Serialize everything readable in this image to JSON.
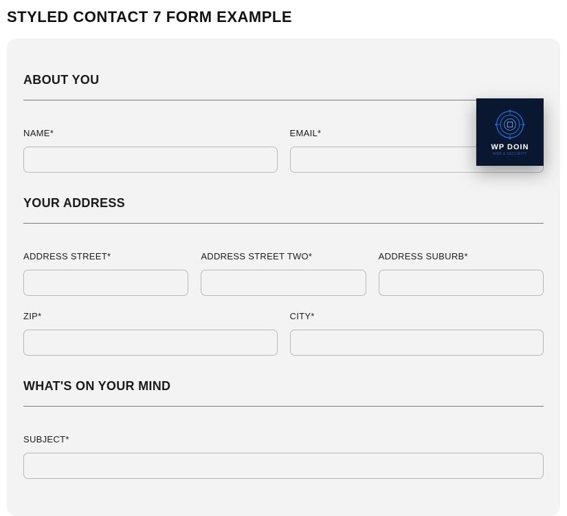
{
  "pageTitle": "STYLED CONTACT 7 FORM EXAMPLE",
  "badge": {
    "text": "WP DOIN",
    "sub": "WEB & SECURITY"
  },
  "sections": {
    "about": {
      "title": "ABOUT YOU",
      "fields": {
        "name": {
          "label": "NAME*",
          "value": ""
        },
        "email": {
          "label": "EMAIL*",
          "value": ""
        }
      }
    },
    "address": {
      "title": "YOUR ADDRESS",
      "fields": {
        "street": {
          "label": "ADDRESS STREET*",
          "value": ""
        },
        "street2": {
          "label": "ADDRESS STREET TWO*",
          "value": ""
        },
        "suburb": {
          "label": "ADDRESS SUBURB*",
          "value": ""
        },
        "zip": {
          "label": "ZIP*",
          "value": ""
        },
        "city": {
          "label": "CITY*",
          "value": ""
        }
      }
    },
    "mind": {
      "title": "WHAT'S ON YOUR MIND",
      "fields": {
        "subject": {
          "label": "SUBJECT*",
          "value": ""
        }
      }
    }
  }
}
